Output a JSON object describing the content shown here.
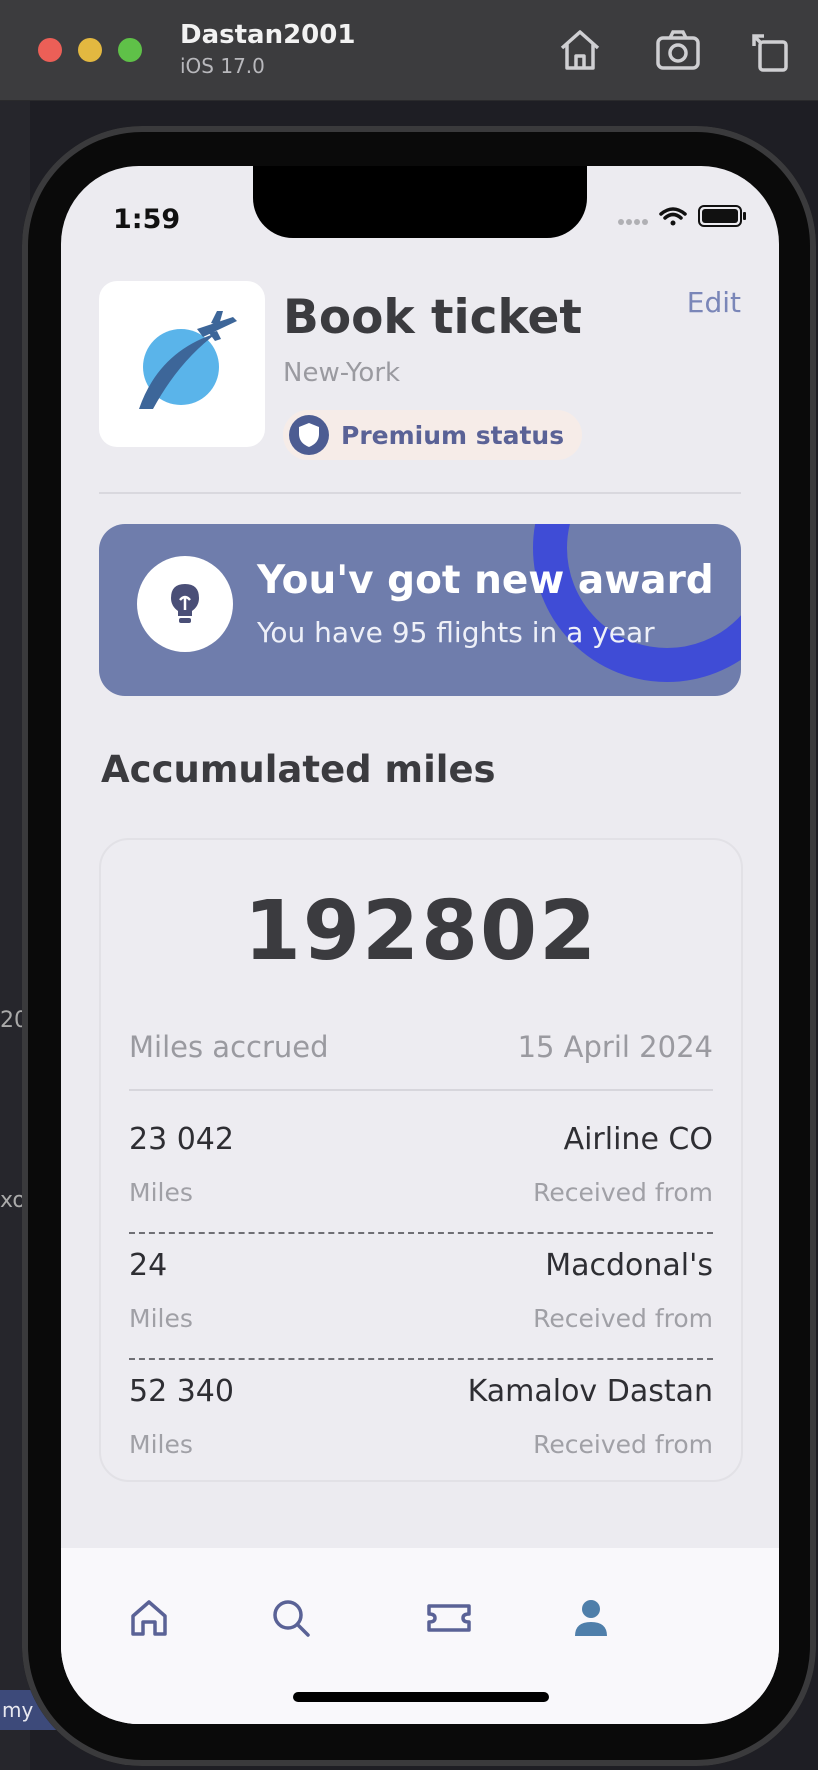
{
  "simulator": {
    "device_name": "Dastan2001",
    "os_version": "iOS 17.0",
    "buttons": [
      "home-icon",
      "screenshot-icon",
      "rotate-icon"
    ]
  },
  "background": {
    "left_edge_text": "20",
    "left_edge_text2": "xo",
    "bottom_left_text": "my"
  },
  "status_bar": {
    "time": "1:59"
  },
  "header": {
    "title": "Book ticket",
    "city": "New-York",
    "badge": "Premium status",
    "edit": "Edit"
  },
  "award": {
    "title": "You'v got new award",
    "subtitle": "You have 95 flights in a year"
  },
  "miles": {
    "section_title": "Accumulated miles",
    "total": "192802",
    "accrued_label": "Miles accrued",
    "accrued_date": "15 April 2024",
    "entries": [
      {
        "amount": "23 042",
        "unit": "Miles",
        "source": "Airline CO",
        "from_label": "Received from"
      },
      {
        "amount": "24",
        "unit": "Miles",
        "source": "Macdonal's",
        "from_label": "Received from"
      },
      {
        "amount": "52 340",
        "unit": "Miles",
        "source": "Kamalov Dastan",
        "from_label": "Received from"
      }
    ]
  },
  "tabbar": {
    "tabs": [
      "home-icon",
      "search-icon",
      "ticket-icon",
      "profile-icon"
    ],
    "active": "profile-icon"
  },
  "colors": {
    "accent": "#6f7dac",
    "badge_text": "#5a6296",
    "award_arc": "#3f4cd6",
    "screen_bg": "#ecebf0"
  }
}
